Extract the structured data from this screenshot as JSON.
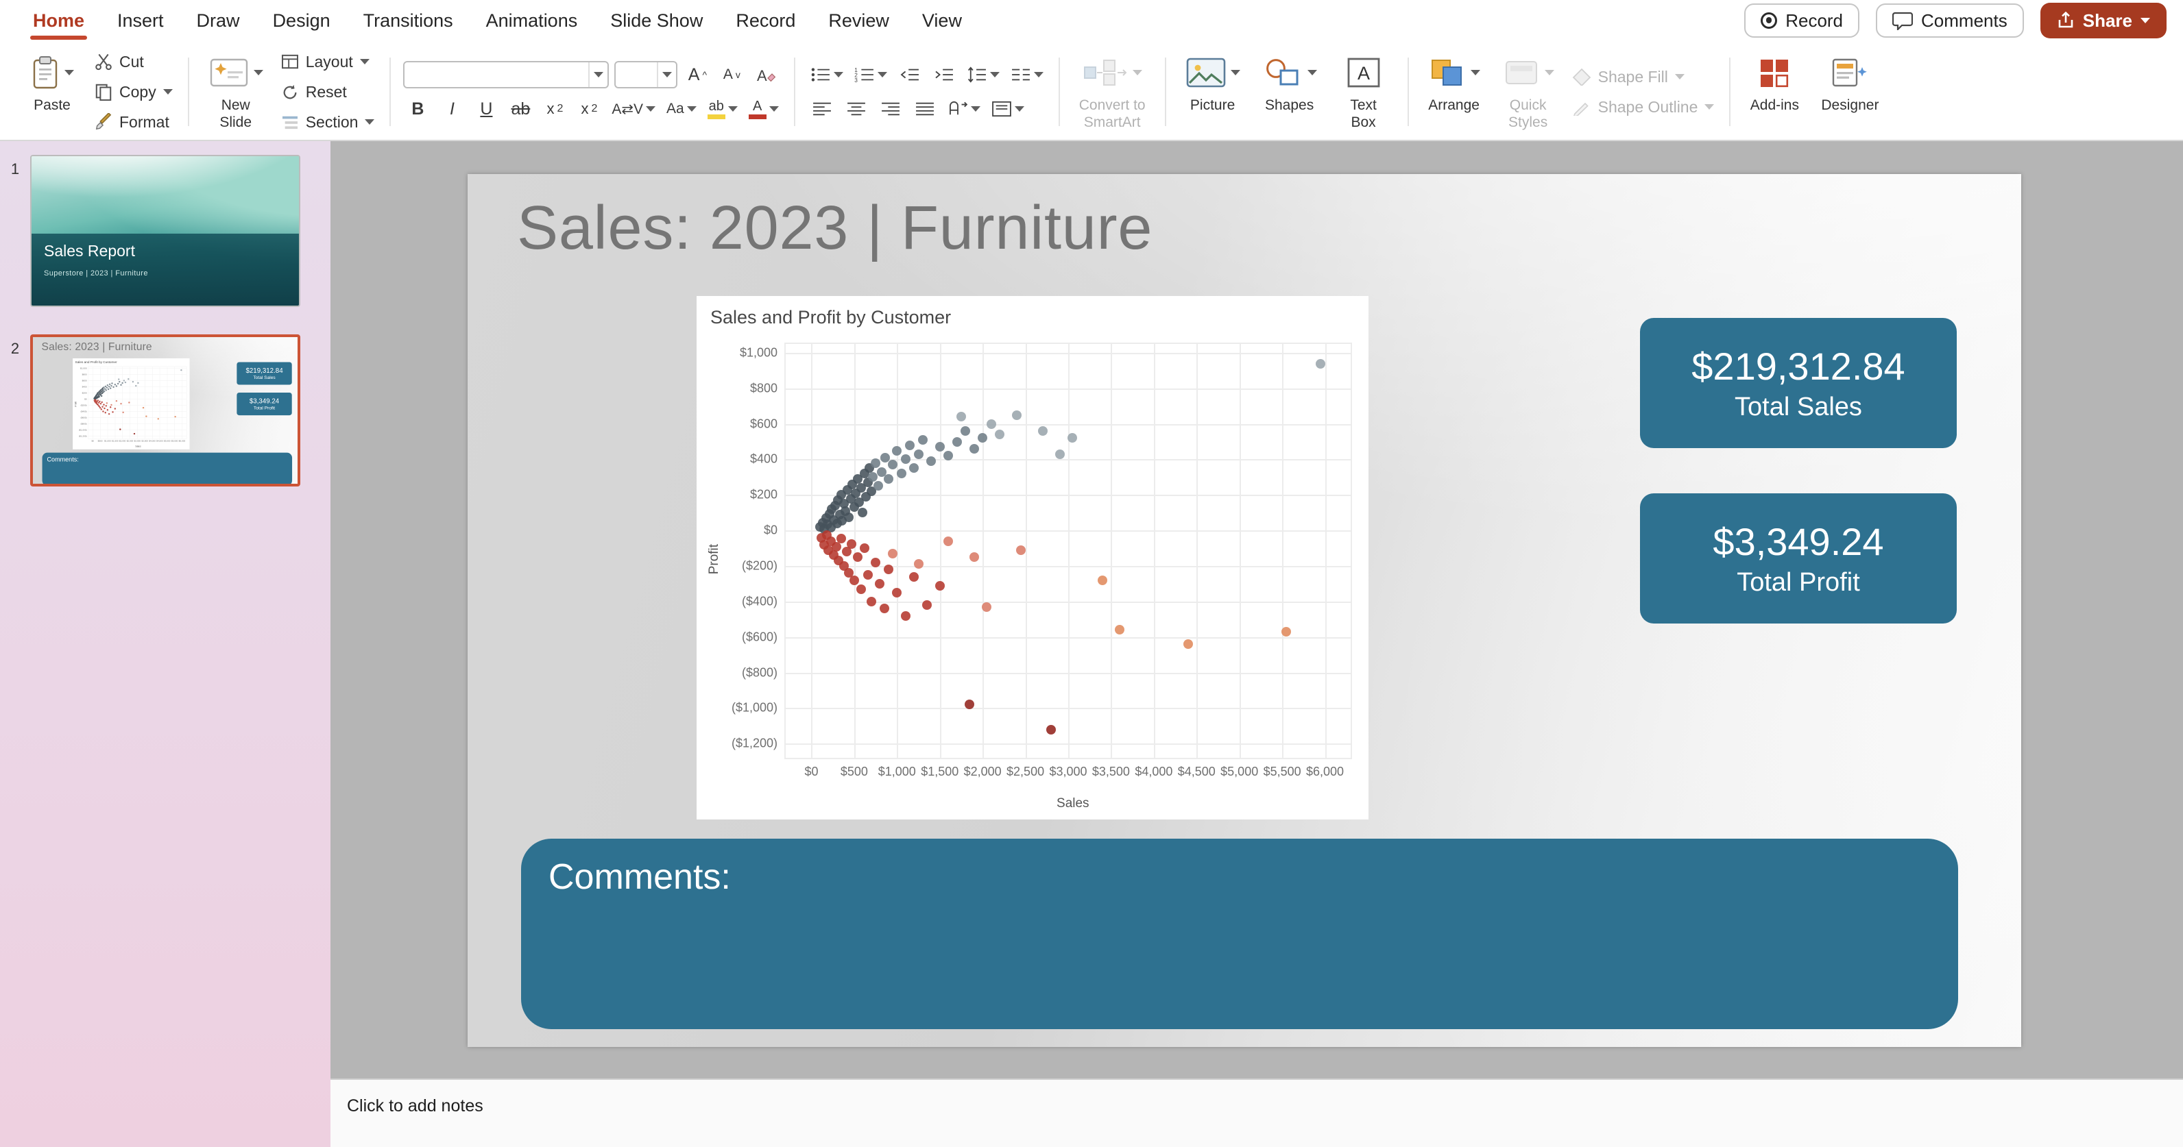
{
  "colors": {
    "accent_teal": "#2E7190",
    "share_button": "#A63A20",
    "active_tab": "#C5472E",
    "selected_slide_border": "#CC5436",
    "positive_points": [
      "#45525B",
      "#6F7D86",
      "#9AA5AC"
    ],
    "negative_points": [
      "#B5382D",
      "#93241E",
      "#D97B66",
      "#E08A5C"
    ]
  },
  "menu_bar": {
    "tabs": [
      "Home",
      "Insert",
      "Draw",
      "Design",
      "Transitions",
      "Animations",
      "Slide Show",
      "Record",
      "Review",
      "View"
    ],
    "active_tab": "Home",
    "record_label": "Record",
    "comments_label": "Comments",
    "share_label": "Share"
  },
  "ribbon": {
    "labels": {
      "paste": "Paste",
      "cut": "Cut",
      "copy": "Copy",
      "format": "Format",
      "new_slide": "New\nSlide",
      "layout": "Layout",
      "reset": "Reset",
      "section": "Section",
      "convert_smartart": "Convert to\nSmartArt",
      "picture": "Picture",
      "shapes": "Shapes",
      "text_box": "Text\nBox",
      "arrange": "Arrange",
      "quick_styles": "Quick\nStyles",
      "shape_fill": "Shape Fill",
      "shape_outline": "Shape Outline",
      "addins": "Add-ins",
      "designer": "Designer"
    },
    "font_name_value": "",
    "font_size_value": ""
  },
  "slide_panel": {
    "slides": [
      {
        "number": "1",
        "title": "Sales Report",
        "subtitle": "Superstore | 2023 | Furniture",
        "selected": false
      },
      {
        "number": "2",
        "title": "Sales: 2023 | Furniture",
        "selected": true
      }
    ]
  },
  "slide": {
    "title": "Sales: 2023 | Furniture",
    "kpi": [
      {
        "value": "$219,312.84",
        "label": "Total Sales"
      },
      {
        "value": "$3,349.24",
        "label": "Total Profit"
      }
    ],
    "comments_label": "Comments:"
  },
  "notes": {
    "placeholder": "Click to add notes"
  },
  "chart_data": {
    "type": "scatter",
    "title": "Sales and Profit by Customer",
    "xlabel": "Sales",
    "ylabel": "Profit",
    "grid": true,
    "legend": "none",
    "x_ticks": [
      "$0",
      "$500",
      "$1,000",
      "$1,500",
      "$2,000",
      "$2,500",
      "$3,000",
      "$3,500",
      "$4,000",
      "$4,500",
      "$5,000",
      "$5,500",
      "$6,000"
    ],
    "x_tick_values": [
      0,
      500,
      1000,
      1500,
      2000,
      2500,
      3000,
      3500,
      4000,
      4500,
      5000,
      5500,
      6000
    ],
    "y_ticks": [
      "$1,000",
      "$800",
      "$600",
      "$400",
      "$200",
      "$0",
      "($200)",
      "($400)",
      "($600)",
      "($800)",
      "($1,000)",
      "($1,200)"
    ],
    "y_tick_values": [
      1000,
      800,
      600,
      400,
      200,
      0,
      -200,
      -400,
      -600,
      -800,
      -1000,
      -1200
    ],
    "x_range": [
      -300,
      6300
    ],
    "y_range": [
      -1280,
      1050
    ],
    "points": [
      [
        100,
        20,
        "#45525B"
      ],
      [
        130,
        45,
        "#45525B"
      ],
      [
        150,
        8,
        "#45525B"
      ],
      [
        170,
        70,
        "#45525B"
      ],
      [
        190,
        35,
        "#45525B"
      ],
      [
        210,
        95,
        "#45525B"
      ],
      [
        230,
        15,
        "#45525B"
      ],
      [
        240,
        120,
        "#45525B"
      ],
      [
        260,
        60,
        "#45525B"
      ],
      [
        280,
        140,
        "#45525B"
      ],
      [
        300,
        40,
        "#45525B"
      ],
      [
        310,
        170,
        "#45525B"
      ],
      [
        330,
        90,
        "#45525B"
      ],
      [
        350,
        200,
        "#45525B"
      ],
      [
        360,
        55,
        "#45525B"
      ],
      [
        380,
        150,
        "#45525B"
      ],
      [
        400,
        110,
        "#45525B"
      ],
      [
        420,
        230,
        "#45525B"
      ],
      [
        440,
        75,
        "#45525B"
      ],
      [
        460,
        180,
        "#45525B"
      ],
      [
        480,
        260,
        "#45525B"
      ],
      [
        500,
        130,
        "#45525B"
      ],
      [
        520,
        210,
        "#45525B"
      ],
      [
        540,
        290,
        "#45525B"
      ],
      [
        560,
        160,
        "#45525B"
      ],
      [
        580,
        240,
        "#45525B"
      ],
      [
        600,
        100,
        "#45525B"
      ],
      [
        620,
        320,
        "#45525B"
      ],
      [
        640,
        190,
        "#45525B"
      ],
      [
        660,
        270,
        "#45525B"
      ],
      [
        680,
        350,
        "#45525B"
      ],
      [
        700,
        220,
        "#45525B"
      ],
      [
        720,
        300,
        "#6F7D86"
      ],
      [
        750,
        380,
        "#6F7D86"
      ],
      [
        780,
        250,
        "#6F7D86"
      ],
      [
        820,
        330,
        "#6F7D86"
      ],
      [
        860,
        410,
        "#6F7D86"
      ],
      [
        900,
        290,
        "#6F7D86"
      ],
      [
        950,
        370,
        "#6F7D86"
      ],
      [
        1000,
        450,
        "#6F7D86"
      ],
      [
        1050,
        320,
        "#6F7D86"
      ],
      [
        1100,
        400,
        "#6F7D86"
      ],
      [
        1150,
        480,
        "#6F7D86"
      ],
      [
        1200,
        350,
        "#6F7D86"
      ],
      [
        1250,
        430,
        "#6F7D86"
      ],
      [
        1300,
        510,
        "#6F7D86"
      ],
      [
        1400,
        390,
        "#6F7D86"
      ],
      [
        1500,
        470,
        "#6F7D86"
      ],
      [
        1600,
        420,
        "#6F7D86"
      ],
      [
        1700,
        500,
        "#6F7D86"
      ],
      [
        1800,
        560,
        "#6F7D86"
      ],
      [
        1900,
        460,
        "#6F7D86"
      ],
      [
        2000,
        520,
        "#6F7D86"
      ],
      [
        1750,
        640,
        "#9AA5AC"
      ],
      [
        2100,
        600,
        "#9AA5AC"
      ],
      [
        2200,
        540,
        "#9AA5AC"
      ],
      [
        2400,
        650,
        "#9AA5AC"
      ],
      [
        2700,
        560,
        "#9AA5AC"
      ],
      [
        2900,
        430,
        "#9AA5AC"
      ],
      [
        3050,
        520,
        "#9AA5AC"
      ],
      [
        5950,
        940,
        "#9AA5AC"
      ],
      [
        120,
        -40,
        "#B5382D"
      ],
      [
        150,
        -80,
        "#B5382D"
      ],
      [
        180,
        -25,
        "#B5382D"
      ],
      [
        200,
        -110,
        "#B5382D"
      ],
      [
        230,
        -60,
        "#B5382D"
      ],
      [
        260,
        -140,
        "#B5382D"
      ],
      [
        290,
        -90,
        "#B5382D"
      ],
      [
        320,
        -170,
        "#B5382D"
      ],
      [
        350,
        -45,
        "#B5382D"
      ],
      [
        380,
        -200,
        "#B5382D"
      ],
      [
        410,
        -120,
        "#B5382D"
      ],
      [
        440,
        -240,
        "#B5382D"
      ],
      [
        470,
        -75,
        "#B5382D"
      ],
      [
        500,
        -280,
        "#B5382D"
      ],
      [
        540,
        -150,
        "#B5382D"
      ],
      [
        580,
        -330,
        "#B5382D"
      ],
      [
        620,
        -100,
        "#B5382D"
      ],
      [
        660,
        -250,
        "#B5382D"
      ],
      [
        700,
        -400,
        "#B5382D"
      ],
      [
        750,
        -180,
        "#B5382D"
      ],
      [
        800,
        -300,
        "#B5382D"
      ],
      [
        850,
        -440,
        "#B5382D"
      ],
      [
        900,
        -220,
        "#B5382D"
      ],
      [
        1000,
        -350,
        "#B5382D"
      ],
      [
        1100,
        -480,
        "#B5382D"
      ],
      [
        1200,
        -260,
        "#B5382D"
      ],
      [
        1350,
        -420,
        "#B5382D"
      ],
      [
        1500,
        -310,
        "#B5382D"
      ],
      [
        1850,
        -980,
        "#93241E"
      ],
      [
        2800,
        -1120,
        "#93241E"
      ],
      [
        950,
        -130,
        "#D97B66"
      ],
      [
        1250,
        -190,
        "#D97B66"
      ],
      [
        1600,
        -60,
        "#D97B66"
      ],
      [
        1900,
        -150,
        "#D97B66"
      ],
      [
        2450,
        -110,
        "#D97B66"
      ],
      [
        2050,
        -430,
        "#D97B66"
      ],
      [
        3400,
        -280,
        "#E08A5C"
      ],
      [
        3600,
        -560,
        "#E08A5C"
      ],
      [
        4400,
        -640,
        "#E08A5C"
      ],
      [
        5550,
        -570,
        "#E08A5C"
      ]
    ]
  }
}
